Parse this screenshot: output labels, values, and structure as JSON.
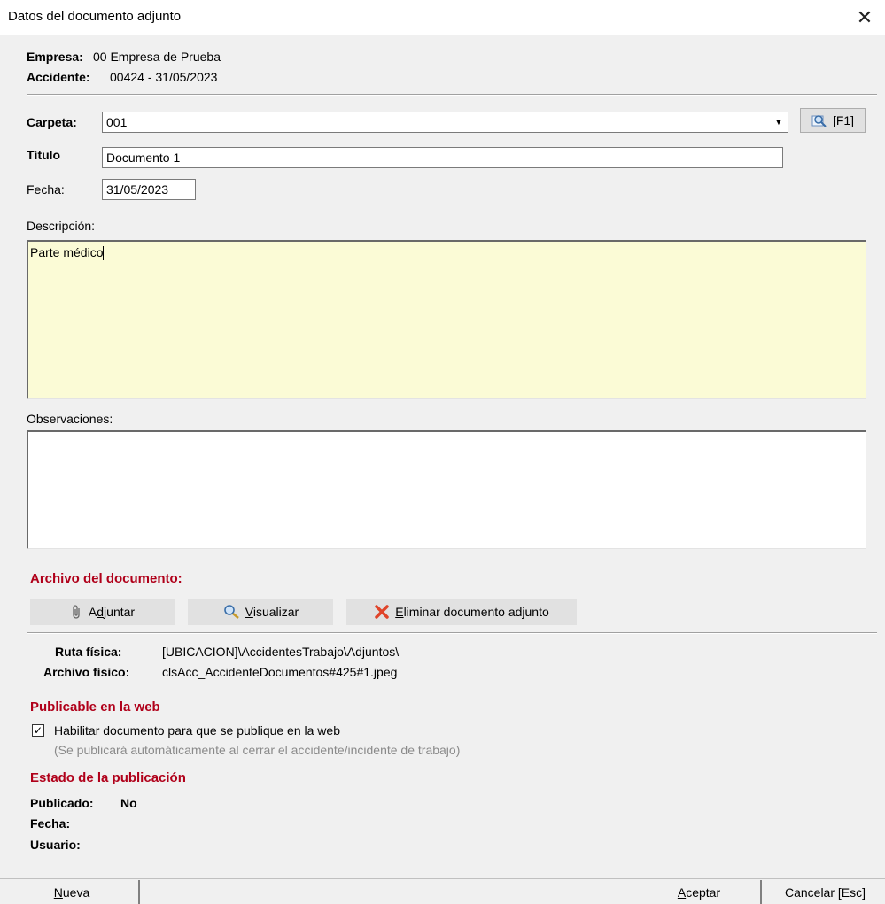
{
  "window": {
    "title": "Datos del documento adjunto",
    "close_glyph": "✕"
  },
  "header": {
    "empresa_label": "Empresa:",
    "empresa_value": "00 Empresa de Prueba",
    "accidente_label": "Accidente:",
    "accidente_value": "00424 - 31/05/2023"
  },
  "form": {
    "carpeta_label": "Carpeta:",
    "carpeta_value": "001",
    "lookup_button": "[F1]",
    "titulo_label": "Título",
    "titulo_value": "Documento 1",
    "fecha_label": "Fecha:",
    "fecha_value": "31/05/2023",
    "descripcion_label": "Descripción:",
    "descripcion_value": "Parte médico",
    "observaciones_label": "Observaciones:",
    "observaciones_value": ""
  },
  "archivo": {
    "section_title": "Archivo del documento:",
    "adjuntar_prefix": "A",
    "adjuntar_ul": "d",
    "adjuntar_rest": "juntar",
    "visualizar_ul": "V",
    "visualizar_rest": "isualizar",
    "eliminar_ul": "E",
    "eliminar_rest": "liminar documento adjunto",
    "ruta_label": "Ruta física:",
    "ruta_value": "[UBICACION]\\AccidentesTrabajo\\Adjuntos\\",
    "archivo_label": "Archivo físico:",
    "archivo_value": "clsAcc_AccidenteDocumentos#425#1.jpeg"
  },
  "web": {
    "section_title": "Publicable en la web",
    "checkbox_checked": true,
    "checkbox_label": "Habilitar documento para que se publique en la web",
    "checkbox_note": "(Se publicará automáticamente al cerrar el accidente/incidente de trabajo)"
  },
  "estado": {
    "section_title": "Estado de la publicación",
    "publicado_label": "Publicado:",
    "publicado_value": "No",
    "fecha_label": "Fecha:",
    "usuario_label": "Usuario:"
  },
  "footer": {
    "nueva_ul": "N",
    "nueva_rest": "ueva",
    "aceptar_ul": "A",
    "aceptar_rest": "ceptar",
    "cancelar_label": "Cancelar [Esc]"
  },
  "colors": {
    "description_bg": "#fbfbd6",
    "section_red": "#b0001a"
  }
}
